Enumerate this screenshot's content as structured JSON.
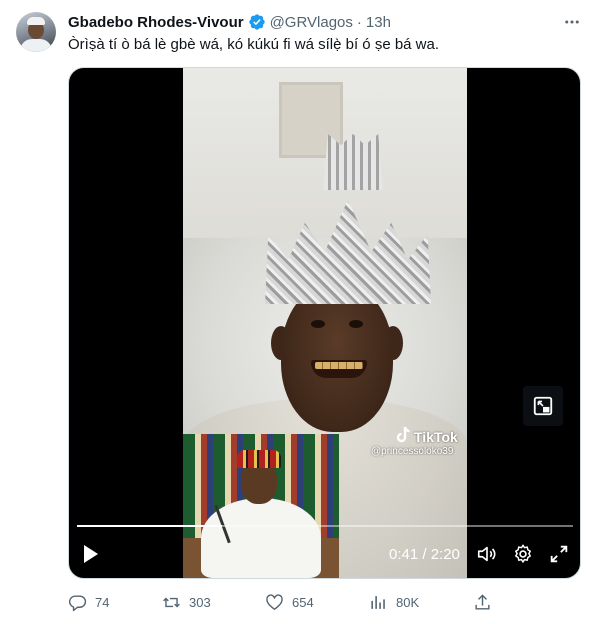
{
  "tweet": {
    "author_name": "Gbadebo Rhodes-Vivour",
    "handle": "@GRVlagos",
    "separator": "·",
    "time": "13h",
    "verified": true,
    "text": "Òrìṣà tí ò bá lè gbè wá, kó kúkú fi wá sílẹ̀ bí ó ṣe bá wa."
  },
  "video": {
    "watermark_brand": "TikTok",
    "watermark_user": "@princessoloko39",
    "current_time": "0:41",
    "duration": "2:20",
    "timecode": "0:41 / 2:20",
    "progress_fraction": 0.293
  },
  "actions": {
    "replies": "74",
    "retweets": "303",
    "likes": "654",
    "views": "80K"
  },
  "icons": {
    "verified": "verified-badge-icon",
    "more": "more-options-icon",
    "pip": "picture-in-picture-icon",
    "play": "play-icon",
    "volume": "volume-icon",
    "settings": "gear-icon",
    "fullscreen": "fullscreen-icon",
    "reply": "reply-icon",
    "retweet": "retweet-icon",
    "like": "heart-icon",
    "views": "views-icon",
    "share": "share-icon"
  },
  "colors": {
    "verified_blue": "#1d9bf0",
    "secondary_text": "#536471",
    "primary_text": "#0f1419"
  }
}
